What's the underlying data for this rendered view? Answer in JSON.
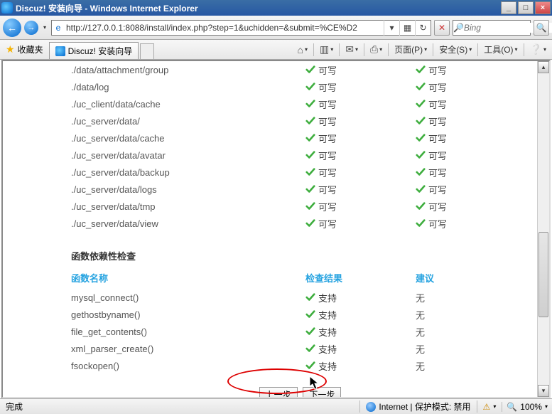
{
  "window": {
    "title": "Discuz! 安装向导 - Windows Internet Explorer",
    "min_symbol": "_",
    "max_symbol": "□",
    "close_symbol": "×"
  },
  "nav": {
    "back_symbol": "←",
    "fwd_symbol": "→",
    "url": "http://127.0.0.1:8088/install/index.php?step=1&uchidden=&submit=%CE%D2",
    "refresh_symbol": "↻",
    "stop_symbol": "✕",
    "search_placeholder": "Bing",
    "search_go": "🔍"
  },
  "fav": {
    "label": "收藏夹",
    "star": "★"
  },
  "tab": {
    "label": "Discuz! 安装向导"
  },
  "cmdbar": {
    "home": "⌂",
    "rss": "▥",
    "mail": "✉",
    "print": "⎙",
    "page": "页面(P)",
    "safety": "安全(S)",
    "tools": "工具(O)",
    "help": "❔"
  },
  "content": {
    "dirs": [
      {
        "path": "./data/attachment/group",
        "writable": "可写",
        "required": "可写"
      },
      {
        "path": "./data/log",
        "writable": "可写",
        "required": "可写"
      },
      {
        "path": "./uc_client/data/cache",
        "writable": "可写",
        "required": "可写"
      },
      {
        "path": "./uc_server/data/",
        "writable": "可写",
        "required": "可写"
      },
      {
        "path": "./uc_server/data/cache",
        "writable": "可写",
        "required": "可写"
      },
      {
        "path": "./uc_server/data/avatar",
        "writable": "可写",
        "required": "可写"
      },
      {
        "path": "./uc_server/data/backup",
        "writable": "可写",
        "required": "可写"
      },
      {
        "path": "./uc_server/data/logs",
        "writable": "可写",
        "required": "可写"
      },
      {
        "path": "./uc_server/data/tmp",
        "writable": "可写",
        "required": "可写"
      },
      {
        "path": "./uc_server/data/view",
        "writable": "可写",
        "required": "可写"
      }
    ],
    "func_section_title": "函数依赖性检查",
    "func_headers": {
      "name": "函数名称",
      "result": "检查结果",
      "suggest": "建议"
    },
    "funcs": [
      {
        "name": "mysql_connect()",
        "result": "支持",
        "suggest": "无"
      },
      {
        "name": "gethostbyname()",
        "result": "支持",
        "suggest": "无"
      },
      {
        "name": "file_get_contents()",
        "result": "支持",
        "suggest": "无"
      },
      {
        "name": "xml_parser_create()",
        "result": "支持",
        "suggest": "无"
      },
      {
        "name": "fsockopen()",
        "result": "支持",
        "suggest": "无"
      }
    ],
    "btn_prev": "上一步",
    "btn_next": "下一步"
  },
  "status": {
    "done": "完成",
    "zone": "Internet | 保护模式: 禁用",
    "zoom": "100%",
    "zoom_symbol": "🔍",
    "protect_off_symbol": "⚠"
  },
  "scroll": {
    "up": "▴",
    "down": "▾"
  }
}
